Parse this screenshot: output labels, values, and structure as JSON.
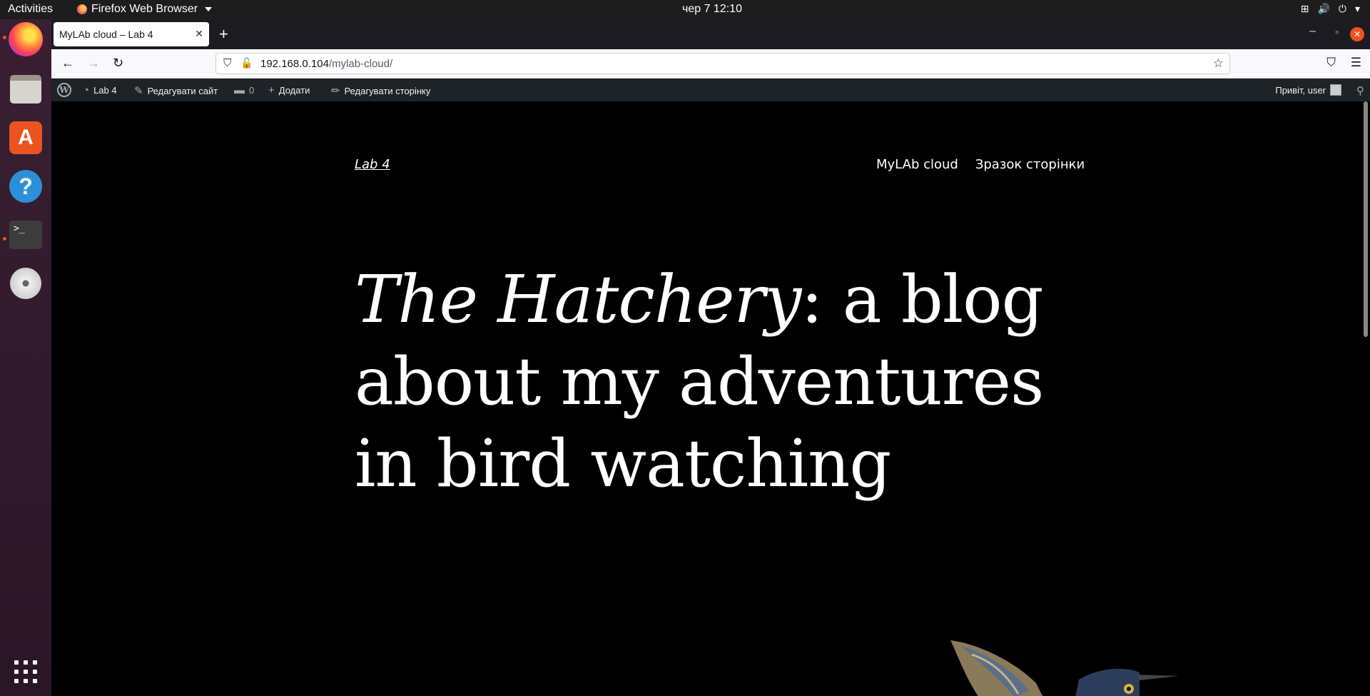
{
  "topbar": {
    "activities": "Activities",
    "app_name": "Firefox Web Browser",
    "clock": "чер 7  12:10"
  },
  "dock": {
    "items": [
      "firefox",
      "files",
      "software",
      "help",
      "terminal",
      "dvd"
    ]
  },
  "browser": {
    "tab_title": "MyLAb cloud – Lab 4",
    "url_host": "192.168.0.104",
    "url_path": "/mylab-cloud/"
  },
  "adminbar": {
    "site_name": "Lab 4",
    "edit_site": "Редагувати сайт",
    "comments_count": "0",
    "add_new": "Додати",
    "edit_page": "Редагувати сторінку",
    "greeting": "Привіт, user"
  },
  "page": {
    "site_title": "Lab 4",
    "nav": [
      "MyLAb cloud",
      "Зразок сторінки"
    ],
    "hero_italic": "The Hatchery",
    "hero_rest": ": a blog about my adventures in bird watching"
  }
}
